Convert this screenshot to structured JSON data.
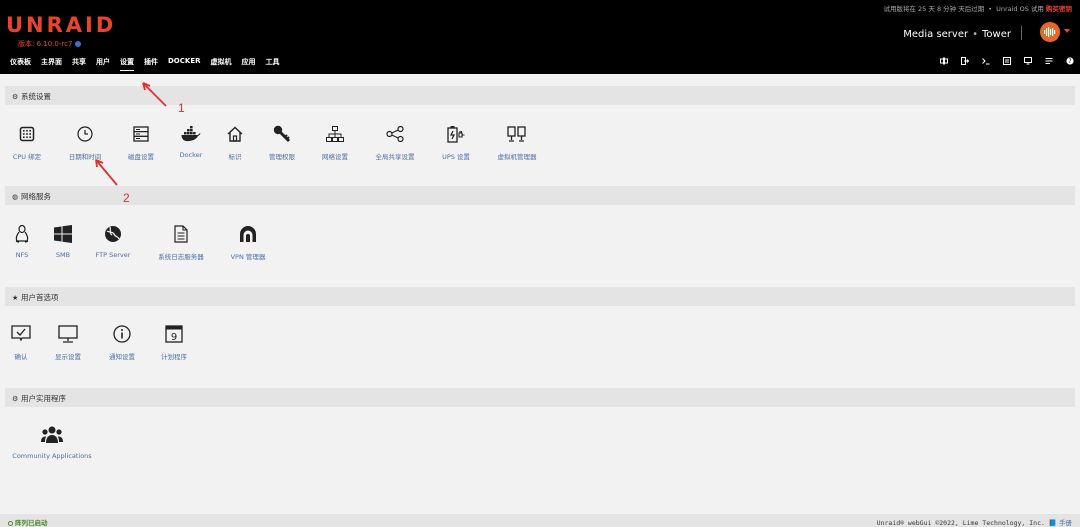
{
  "header": {
    "logo": "UNRAID",
    "version": "版本: 6.10.0-rc7",
    "trial_notice": "试用版将在 25 天 8 分钟 天后过期",
    "trial_os": "Unraid OS 试用",
    "buy_key": "购买密钥",
    "server_desc": "Media server",
    "server_name": "Tower"
  },
  "nav": {
    "items": [
      "仪表板",
      "主界面",
      "共享",
      "用户",
      "设置",
      "插件",
      "DOCKER",
      "虚拟机",
      "应用",
      "工具"
    ],
    "active": "设置"
  },
  "sections": {
    "system": {
      "title": "系统设置",
      "items": [
        "CPU 绑定",
        "日期和时间",
        "磁盘设置",
        "Docker",
        "标识",
        "管理权限",
        "网络设置",
        "全局共享设置",
        "UPS 设置",
        "虚拟机管理器"
      ]
    },
    "network": {
      "title": "网络服务",
      "items": [
        "NFS",
        "SMB",
        "FTP Server",
        "系统日志服务器",
        "VPN 管理器"
      ]
    },
    "user_prefs": {
      "title": "用户首选项",
      "items": [
        "确认",
        "显示设置",
        "通知设置",
        "计划程序"
      ],
      "calendar_day": "9"
    },
    "user_utils": {
      "title": "用户实用程序",
      "items": [
        "Community Applications"
      ]
    }
  },
  "footer": {
    "status": "阵列已启动",
    "copyright": "Unraid® webGui ©2022, Lime Technology, Inc.",
    "manual": "手册"
  },
  "annotations": [
    "1",
    "2"
  ],
  "colors": {
    "brand": "#e8452c",
    "link": "#4a6ea8",
    "annotation": "#e03030",
    "status_green": "#4a8a2a"
  }
}
